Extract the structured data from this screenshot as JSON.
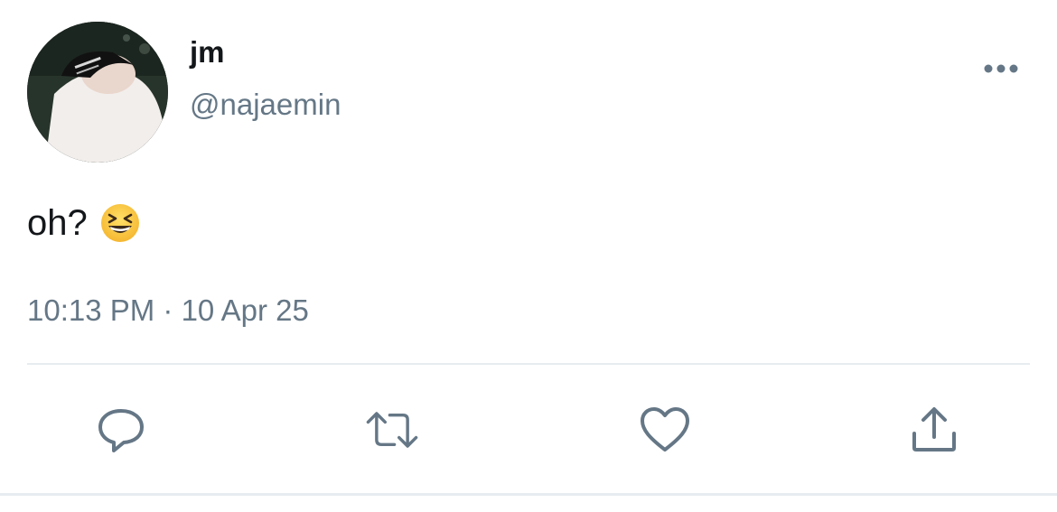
{
  "user": {
    "display_name": "jm",
    "handle": "@najaemin",
    "avatar_icon": "profile-photo"
  },
  "tweet": {
    "text": "oh?",
    "emoji": "grinning-squinting-face",
    "timestamp": "10:13 PM · 10 Apr 25"
  },
  "actions": {
    "more_icon": "more-dots-icon",
    "reply_icon": "reply-icon",
    "retweet_icon": "retweet-icon",
    "like_icon": "heart-icon",
    "share_icon": "share-icon"
  },
  "colors": {
    "primary_text": "#14171a",
    "secondary_text": "#657786",
    "divider": "#e6ecf0",
    "icon": "#657786"
  }
}
